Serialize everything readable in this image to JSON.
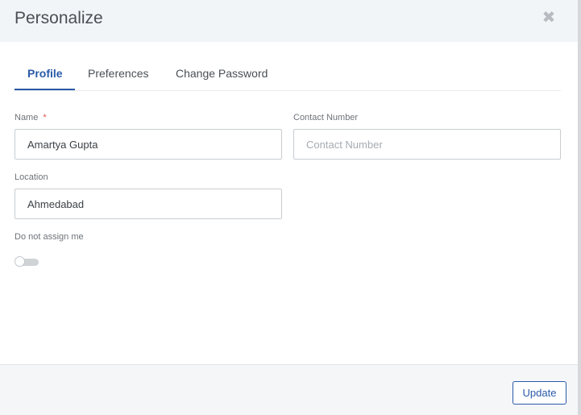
{
  "dialog": {
    "title": "Personalize",
    "close_icon": "close-icon",
    "close_glyph": "✖"
  },
  "tabs": [
    {
      "label": "Profile",
      "active": true
    },
    {
      "label": "Preferences",
      "active": false
    },
    {
      "label": "Change Password",
      "active": false
    }
  ],
  "form": {
    "name": {
      "label": "Name",
      "required_mark": "*",
      "value": "Amartya Gupta"
    },
    "contact": {
      "label": "Contact Number",
      "value": "",
      "placeholder": "Contact Number"
    },
    "location": {
      "label": "Location",
      "value": "Ahmedabad"
    },
    "do_not_assign": {
      "label": "Do not assign me",
      "on": false
    }
  },
  "footer": {
    "update_label": "Update"
  },
  "colors": {
    "accent": "#2a5aa8",
    "header_bg": "#f2f5f7",
    "required": "#d9534f"
  }
}
